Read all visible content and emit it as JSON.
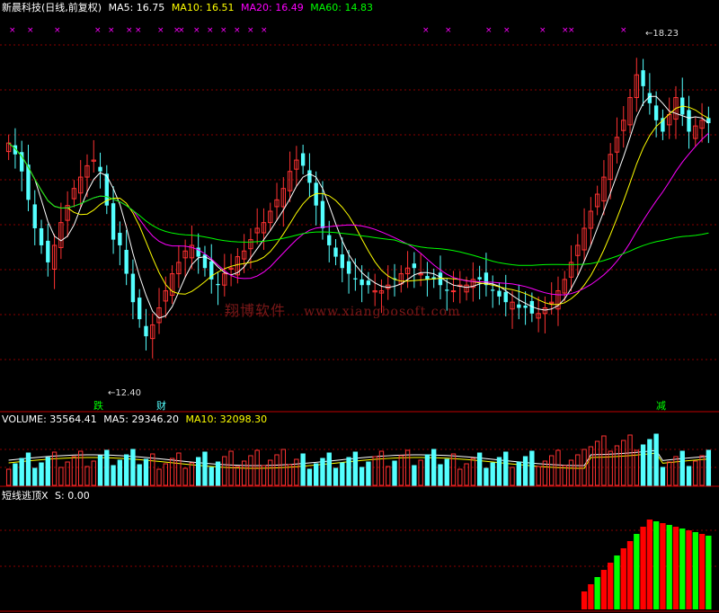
{
  "price_header": {
    "title": "新晨科技(日线,前复权)",
    "ma5": "MA5: 16.75",
    "ma10": "MA10: 16.51",
    "ma20": "MA20: 16.49",
    "ma60": "MA60: 14.83"
  },
  "volume_header": {
    "volume": "VOLUME: 35564.41",
    "ma5": "MA5: 29346.20",
    "ma10": "MA10: 32098.30"
  },
  "indicator_header": {
    "name": "短线逃顶X",
    "value": "S: 0.00"
  },
  "annotations": {
    "high_label": "18.23",
    "low_label": "12.40",
    "marker_die": "跌",
    "marker_cai": "财",
    "marker_jian": "减"
  },
  "watermark": {
    "text": "翔博软件",
    "url": "www.xiangbosoft.com"
  },
  "colors": {
    "up": "#ff3232",
    "down": "#54ffff",
    "ma5": "#ffffff",
    "ma10": "#ffff00",
    "ma20": "#ff00ff",
    "ma60": "#00ff00",
    "indicator_up": "#ff0000",
    "indicator_down": "#00ff00",
    "grid": "#8a0000"
  },
  "chart_data": {
    "type": "candlestick",
    "price_range": [
      11.8,
      18.6
    ],
    "high": 18.23,
    "low": 12.4,
    "closes": [
      16.4,
      16.2,
      15.9,
      15.4,
      14.9,
      14.6,
      14.3,
      14.6,
      15.0,
      15.3,
      15.6,
      15.8,
      16.0,
      16.1,
      15.9,
      15.3,
      14.7,
      14.6,
      14.1,
      13.6,
      13.3,
      13.0,
      13.2,
      13.5,
      13.8,
      14.1,
      14.3,
      14.5,
      14.6,
      14.4,
      14.2,
      14.0,
      13.9,
      14.1,
      14.2,
      14.4,
      14.5,
      14.7,
      14.9,
      15.0,
      15.2,
      15.4,
      15.6,
      15.9,
      16.1,
      16.0,
      15.7,
      15.3,
      14.9,
      14.6,
      14.4,
      14.2,
      14.1,
      14.0,
      13.9,
      13.9,
      13.8,
      13.8,
      13.9,
      14.0,
      14.1,
      14.2,
      14.2,
      14.1,
      14.0,
      14.0,
      13.9,
      13.8,
      13.8,
      13.9,
      13.9,
      14.0,
      14.0,
      13.9,
      13.8,
      13.7,
      13.6,
      13.6,
      13.5,
      13.5,
      13.4,
      13.4,
      13.5,
      13.6,
      13.8,
      14.0,
      14.3,
      14.6,
      14.9,
      15.2,
      15.5,
      15.8,
      16.2,
      16.5,
      16.8,
      17.2,
      17.6,
      17.4,
      17.1,
      16.8,
      16.6,
      16.9,
      17.2,
      16.9,
      16.6,
      16.7,
      16.8,
      16.75
    ]
  }
}
